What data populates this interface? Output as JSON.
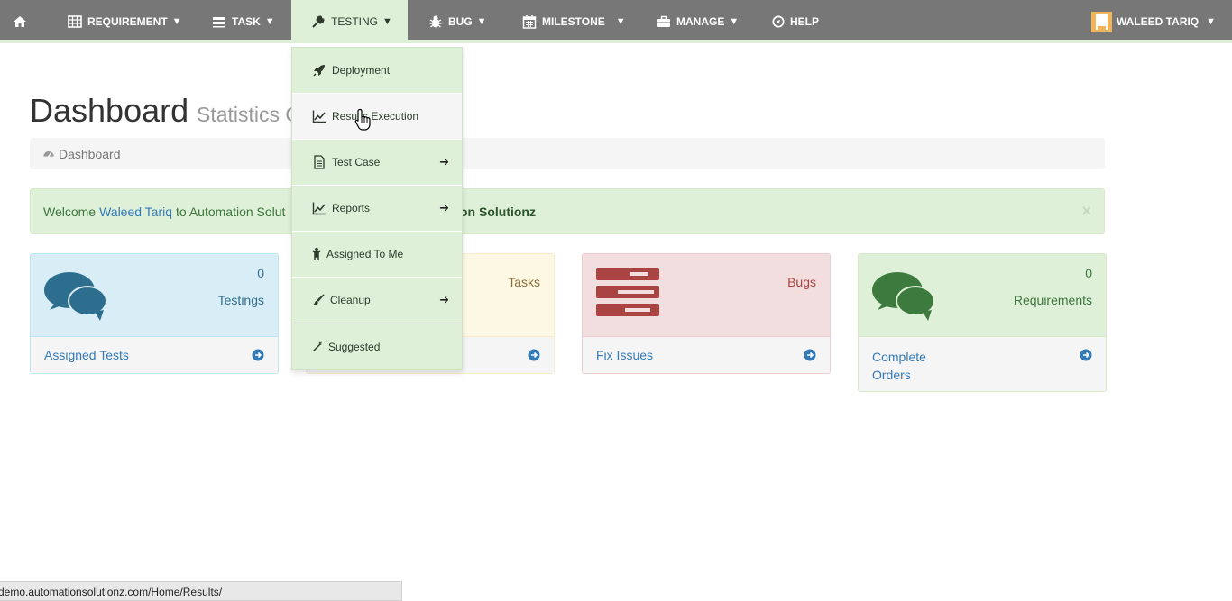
{
  "nav": {
    "home_icon": "home-icon",
    "items": [
      {
        "label": "REQUIREMENT",
        "icon": "table-icon"
      },
      {
        "label": "TASK",
        "icon": "tasks-icon"
      },
      {
        "label": "TESTING",
        "icon": "wrench-icon"
      },
      {
        "label": "BUG",
        "icon": "bug-icon"
      },
      {
        "label": "MILESTONE",
        "icon": "calendar-icon"
      },
      {
        "label": "MANAGE",
        "icon": "briefcase-icon"
      },
      {
        "label": "HELP",
        "icon": "compass-icon"
      }
    ],
    "caret": "▼",
    "user": "WALEED TARIQ"
  },
  "dropdown": {
    "items": [
      {
        "label": "Deployment",
        "icon": "rocket-icon"
      },
      {
        "label": "Results Execution",
        "icon": "line-chart-icon"
      },
      {
        "label": "Test Case",
        "icon": "file-text-icon",
        "arrow": "➜"
      },
      {
        "label": "Reports",
        "icon": "line-chart-icon",
        "arrow": "➜"
      },
      {
        "label": "Assigned To Me",
        "icon": "child-icon"
      },
      {
        "label": "Cleanup",
        "icon": "paint-brush-icon",
        "arrow": "➜"
      },
      {
        "label": "Suggested",
        "icon": "magic-icon"
      }
    ]
  },
  "page": {
    "title": "Dashboard",
    "subtitle": "Statistics O",
    "breadcrumb": "Dashboard"
  },
  "alert": {
    "prefix": "Welcome",
    "user": "Waleed Tariq",
    "text": "to Automation Solut",
    "brand": "on Solutionz",
    "close": "×"
  },
  "panels": [
    {
      "count": "0",
      "label": "Testings",
      "link": "Assigned Tests"
    },
    {
      "count": "",
      "label": "Tasks",
      "link": ""
    },
    {
      "count": "",
      "label": "Bugs",
      "link": "Fix Issues"
    },
    {
      "count": "0",
      "label": "Requirements",
      "link": "Complete Orders"
    }
  ],
  "status_bar": "demo.automationsolutionz.com/Home/Results/",
  "colors": {
    "navbar": "#777777",
    "accent_green": "#dff0d8",
    "link": "#337ab7"
  }
}
